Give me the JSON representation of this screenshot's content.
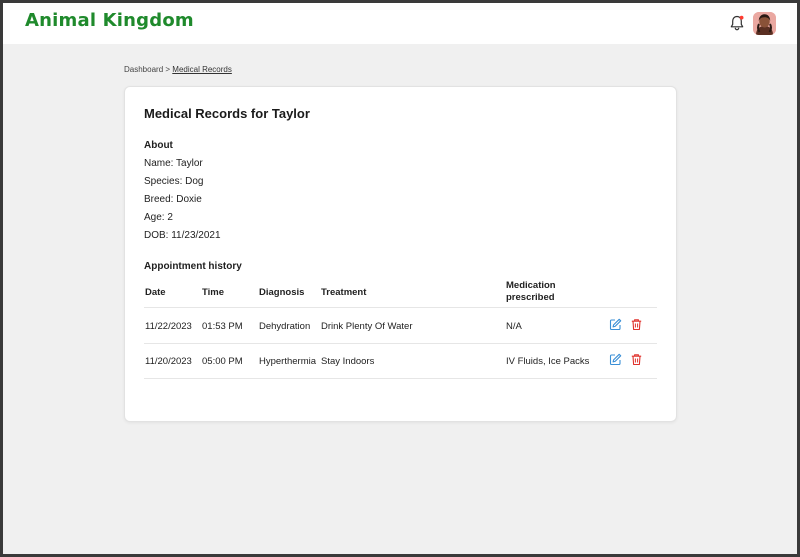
{
  "app": {
    "brand": "Animal Kingdom",
    "icons": {
      "notifications": "bell-icon",
      "profile": "avatar"
    }
  },
  "breadcrumb": {
    "root": "Dashboard",
    "separator": ">",
    "current": "Medical Records"
  },
  "record": {
    "title": "Medical Records for Taylor",
    "about_heading": "About",
    "about": [
      "Name: Taylor",
      "Species: Dog",
      "Breed: Doxie",
      "Age: 2",
      "DOB: 11/23/2021"
    ]
  },
  "history": {
    "heading": "Appointment history",
    "columns": {
      "date": "Date",
      "time": "Time",
      "diagnosis": "Diagnosis",
      "treatment": "Treatment",
      "medication_line1": "Medication",
      "medication_line2": "prescribed"
    },
    "rows": [
      {
        "date": "11/22/2023",
        "time": "01:53 PM",
        "diagnosis": "Dehydration",
        "treatment": "Drink Plenty Of Water",
        "medication": "N/A"
      },
      {
        "date": "11/20/2023",
        "time": "05:00 PM",
        "diagnosis": "Hyperthermia",
        "treatment": "Stay Indoors",
        "medication": "IV Fluids, Ice Packs"
      }
    ],
    "row_actions": {
      "edit_icon": "edit-icon",
      "delete_icon": "trash-icon"
    }
  },
  "colors": {
    "brand": "#1f8a2c",
    "edit": "#3b8fd6",
    "delete": "#e0312b"
  }
}
